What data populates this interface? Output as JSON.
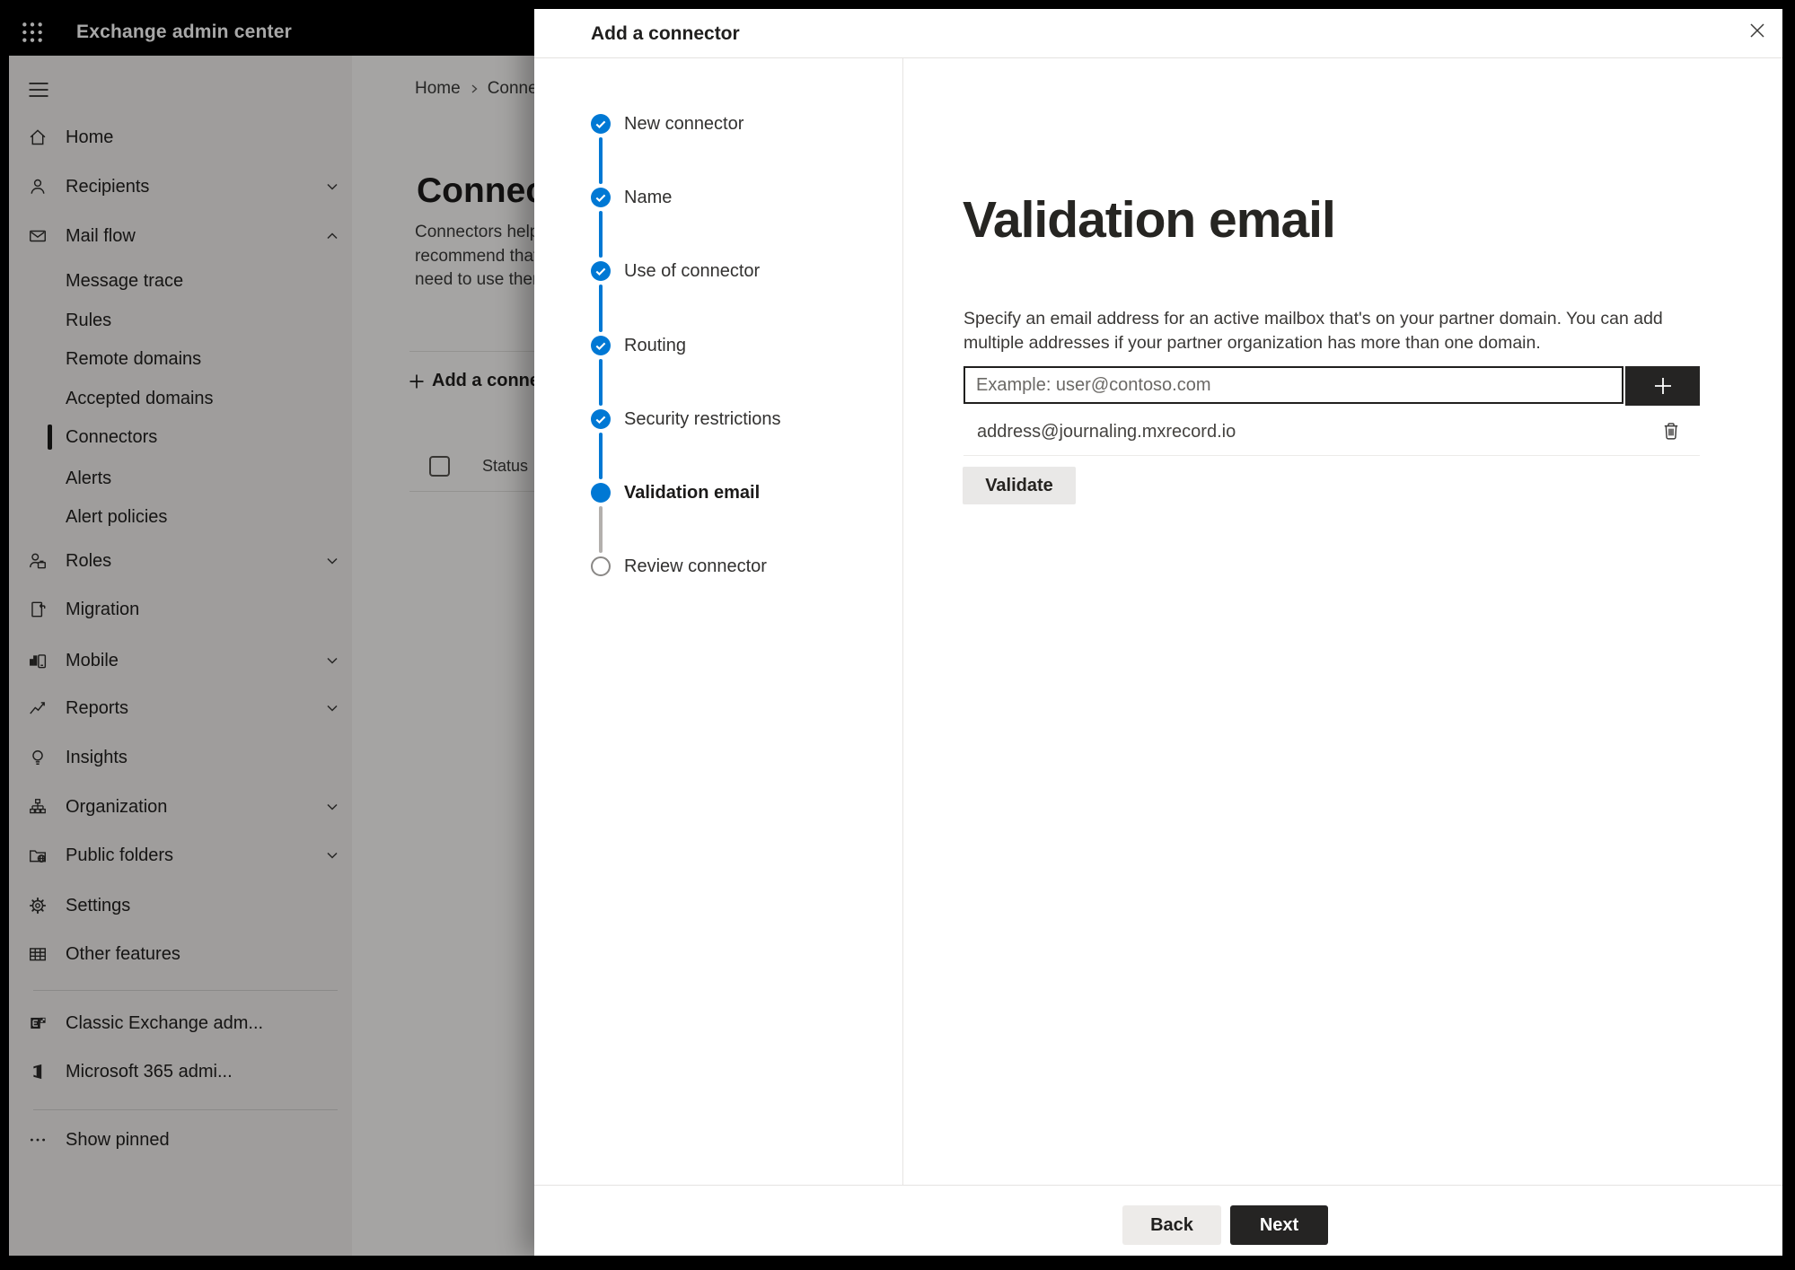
{
  "topbar": {
    "title": "Exchange admin center"
  },
  "sidebar": {
    "items": [
      {
        "label": "Home"
      },
      {
        "label": "Recipients"
      },
      {
        "label": "Mail flow"
      },
      {
        "label": "Message trace"
      },
      {
        "label": "Rules"
      },
      {
        "label": "Remote domains"
      },
      {
        "label": "Accepted domains"
      },
      {
        "label": "Connectors"
      },
      {
        "label": "Alerts"
      },
      {
        "label": "Alert policies"
      },
      {
        "label": "Roles"
      },
      {
        "label": "Migration"
      },
      {
        "label": "Mobile"
      },
      {
        "label": "Reports"
      },
      {
        "label": "Insights"
      },
      {
        "label": "Organization"
      },
      {
        "label": "Public folders"
      },
      {
        "label": "Settings"
      },
      {
        "label": "Other features"
      },
      {
        "label": "Classic Exchange adm..."
      },
      {
        "label": "Microsoft 365 admi..."
      },
      {
        "label": "Show pinned"
      }
    ]
  },
  "page": {
    "breadcrumb": {
      "home": "Home",
      "current": "Connectors"
    },
    "title": "Connectors",
    "description_lines": {
      "l1": "Connectors help",
      "l2": "recommend that",
      "l3": "need to use them"
    },
    "toolbar": {
      "add_label": "Add a connector"
    },
    "table": {
      "status_header": "Status"
    }
  },
  "dialog": {
    "title": "Add a connector",
    "steps": [
      {
        "label": "New connector",
        "state": "completed"
      },
      {
        "label": "Name",
        "state": "completed"
      },
      {
        "label": "Use of connector",
        "state": "completed"
      },
      {
        "label": "Routing",
        "state": "completed"
      },
      {
        "label": "Security restrictions",
        "state": "completed"
      },
      {
        "label": "Validation email",
        "state": "current"
      },
      {
        "label": "Review connector",
        "state": "upcoming"
      }
    ],
    "content": {
      "heading": "Validation email",
      "description": "Specify an email address for an active mailbox that's on your partner domain. You can add multiple addresses if your partner organization has more than one domain.",
      "email_input": {
        "value": "",
        "placeholder": "Example: user@contoso.com"
      },
      "added_addresses": [
        "address@journaling.mxrecord.io"
      ],
      "validate_label": "Validate"
    },
    "footer": {
      "back_label": "Back",
      "next_label": "Next"
    }
  },
  "colors": {
    "accent_blue": "#0078d4",
    "dark_button": "#252423",
    "neutral_button": "#edebe9",
    "topbar_bg": "#000000",
    "sidebar_bg": "#f1efed"
  }
}
